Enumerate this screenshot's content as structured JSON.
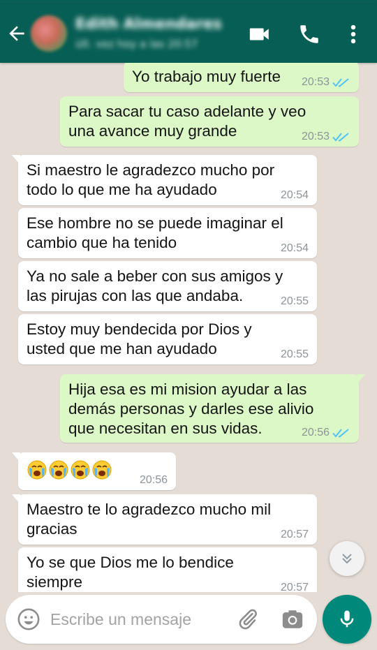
{
  "header": {
    "contact_name": "Edith Almendares",
    "status": "últ. vez hoy a las 20:57"
  },
  "messages": [
    {
      "direction": "out",
      "text": "Yo trabajo muy fuerte",
      "time": "20:53",
      "read": true
    },
    {
      "direction": "out",
      "text": "Para sacar tu caso adelante y veo\nuna avance muy grande",
      "time": "20:53",
      "read": true
    },
    {
      "direction": "in",
      "text": "Si maestro le agradezco mucho por\ntodo lo que me ha ayudado",
      "time": "20:54"
    },
    {
      "direction": "in",
      "text": "Ese hombre no se puede imaginar el\ncambio que ha tenido",
      "time": "20:54"
    },
    {
      "direction": "in",
      "text": "Ya no sale a beber con sus amigos y\nlas pirujas con las que andaba.",
      "time": "20:55"
    },
    {
      "direction": "in",
      "text": "Estoy muy bendecida por Dios y\nusted que me han ayudado",
      "time": "20:55"
    },
    {
      "direction": "out",
      "text": "Hija esa es mi mision ayudar a las\ndemás personas y darles ese alivio\nque necesitan en sus vidas.",
      "time": "20:56",
      "read": true
    },
    {
      "direction": "in",
      "emoji": [
        "loudly-crying-face",
        "loudly-crying-face",
        "loudly-crying-face",
        "loudly-crying-face"
      ],
      "time": "20:56"
    },
    {
      "direction": "in",
      "text": "Maestro te lo agradezco mucho mil\ngracias",
      "time": "20:57"
    },
    {
      "direction": "in",
      "text": "Yo se que Dios me lo bendice\nsiempre",
      "time": "20:57"
    }
  ],
  "composer": {
    "placeholder": "Escribe un mensaje"
  },
  "colors": {
    "header": "#075e54",
    "chat_background": "#e5ddd5",
    "outgoing_bubble": "#dcf8c6",
    "incoming_bubble": "#ffffff",
    "read_ticks": "#4fc3f7",
    "mic_button": "#00897b"
  },
  "icons": {
    "back": "arrow-left-icon",
    "video": "video-camera-icon",
    "call": "phone-icon",
    "menu": "more-vertical-icon",
    "scroll_down": "double-chevron-down-icon",
    "emoji": "emoji-icon",
    "attach": "paperclip-icon",
    "camera": "camera-icon",
    "mic": "microphone-icon"
  }
}
